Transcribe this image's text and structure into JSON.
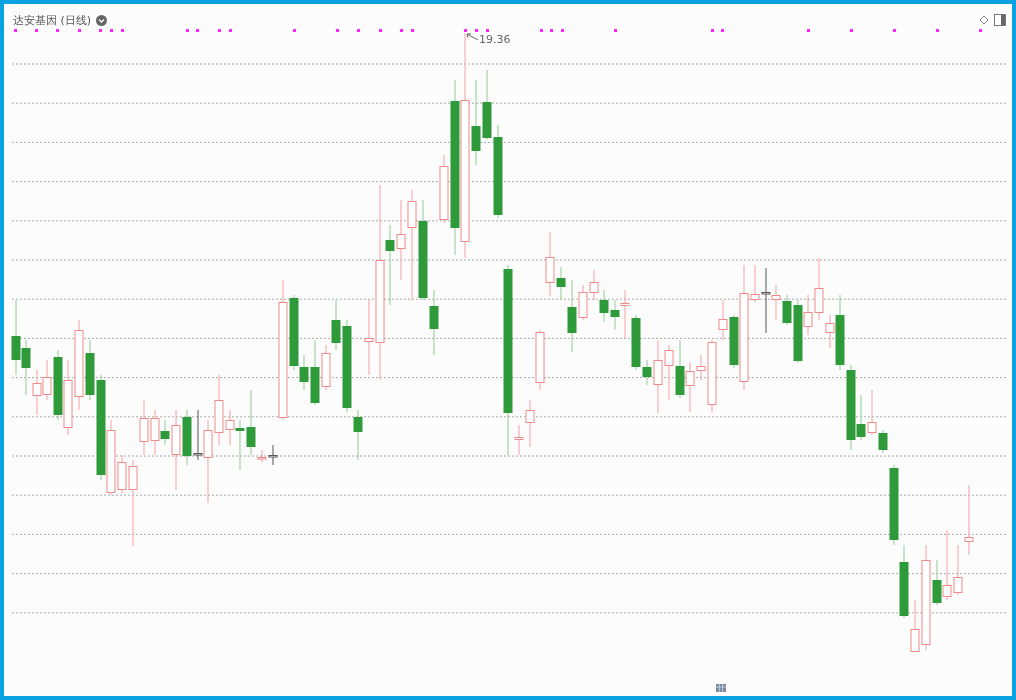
{
  "chart": {
    "title": "达安基因 (日线)",
    "max_label": "19.36"
  }
}
